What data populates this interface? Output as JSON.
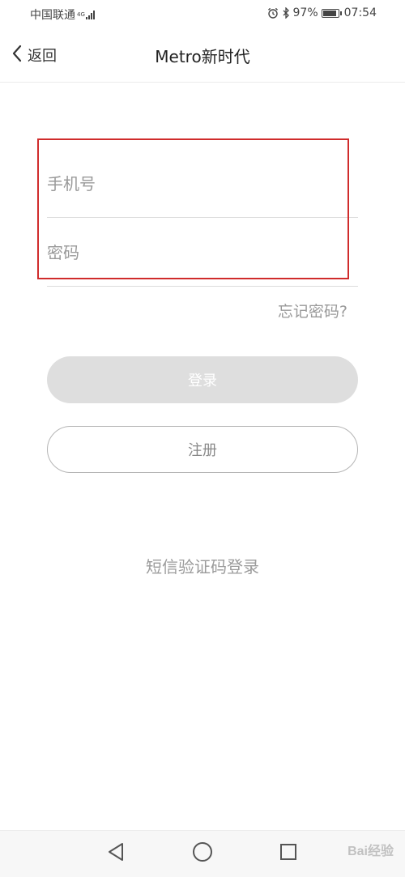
{
  "status_bar": {
    "carrier": "中国联通",
    "network": "4G",
    "battery_percent": "97%",
    "battery_level": 0.97,
    "time": "07:54",
    "icons": [
      "alarm-icon",
      "bluetooth-icon",
      "battery-icon",
      "signal-icon"
    ]
  },
  "nav": {
    "back_label": "返回",
    "title": "Metro新时代"
  },
  "form": {
    "phone_placeholder": "手机号",
    "password_placeholder": "密码",
    "forgot_password": "忘记密码?",
    "login_label": "登录",
    "register_label": "注册",
    "sms_login": "短信验证码登录"
  },
  "system_nav": {
    "icons": [
      "back-triangle-icon",
      "home-circle-icon",
      "recents-square-icon"
    ]
  },
  "watermark": {
    "text": "Bai经验"
  },
  "colors": {
    "highlight": "#d02c2c",
    "login_button_bg": "#dedede",
    "placeholder": "#999999"
  }
}
